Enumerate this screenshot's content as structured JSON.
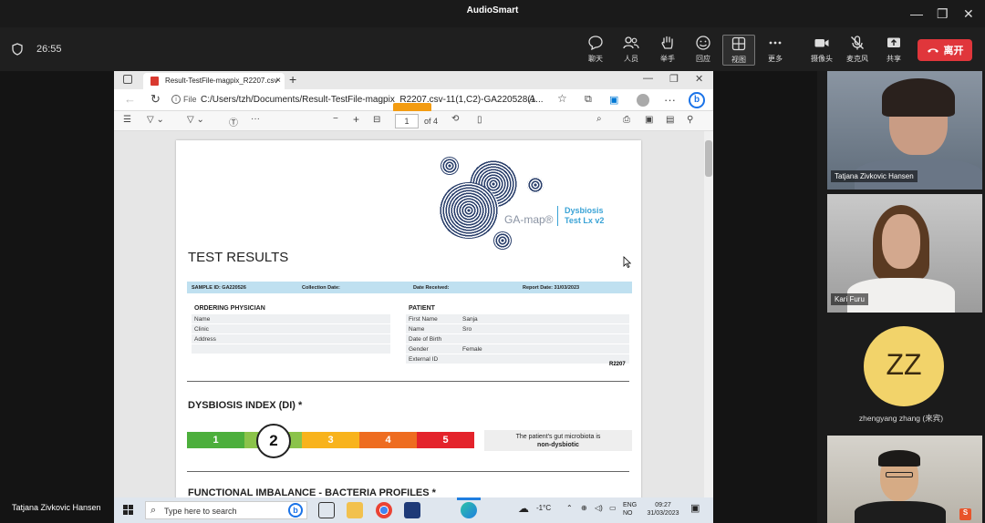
{
  "app": {
    "title": "AudioSmart",
    "timer": "26:55"
  },
  "toolbar": {
    "chat": "聊天",
    "people": "人员",
    "raise_hand": "举手",
    "react": "回应",
    "view": "视图",
    "more": "更多",
    "camera": "摄像头",
    "mic": "麦克风",
    "share": "共享",
    "leave": "离开"
  },
  "browser": {
    "tab_title": "Result-TestFile-magpix_R2207.csv",
    "address_label": "File",
    "address": "C:/Users/tzh/Documents/Result-TestFile-magpix_R2207.csv-11(1,C2)-GA220528(1...",
    "page_current": "1",
    "page_total": "of 4"
  },
  "document": {
    "brand": "GA-map®",
    "product_line1": "Dysbiosis",
    "product_line2": "Test Lx v2",
    "heading": "TEST RESULTS",
    "sample_id": "SAMPLE ID: GA220526",
    "collection_date": "Collection Date:",
    "date_received": "Date Received:",
    "report_date": "Report Date: 31/03/2023",
    "ordering_physician": "ORDERING PHYSICIAN",
    "physician_fields": [
      "Name",
      "Clinic",
      "Address"
    ],
    "patient_heading": "PATIENT",
    "patient_rows": [
      {
        "k": "First Name",
        "v": "Sanja"
      },
      {
        "k": "Name",
        "v": "Sro"
      },
      {
        "k": "Date of Birth",
        "v": ""
      },
      {
        "k": "Gender",
        "v": "Female"
      },
      {
        "k": "External ID",
        "v": ""
      }
    ],
    "report_code": "R2207",
    "di_heading": "DYSBIOSIS INDEX (DI) *",
    "di_scale": [
      "1",
      "2",
      "3",
      "4",
      "5"
    ],
    "di_value": 2,
    "verdict_line1": "The patient's gut microbiota is",
    "verdict_line2": "non-dysbiotic",
    "section2_heading": "FUNCTIONAL IMBALANCE - BACTERIA PROFILES *"
  },
  "taskbar": {
    "search_placeholder": "Type here to search",
    "weather": "-1°C",
    "lang1": "ENG",
    "lang2": "NO",
    "time": "09:27",
    "date": "31/03/2023"
  },
  "speaker_name": "Tatjana Zivkovic Hansen",
  "participants": [
    {
      "name": "Tatjana Zivkovic Hansen"
    },
    {
      "name": "Kari Furu"
    },
    {
      "name": "zhengyang zhang (来宾)",
      "initials": "ZZ"
    },
    {
      "name": ""
    }
  ]
}
